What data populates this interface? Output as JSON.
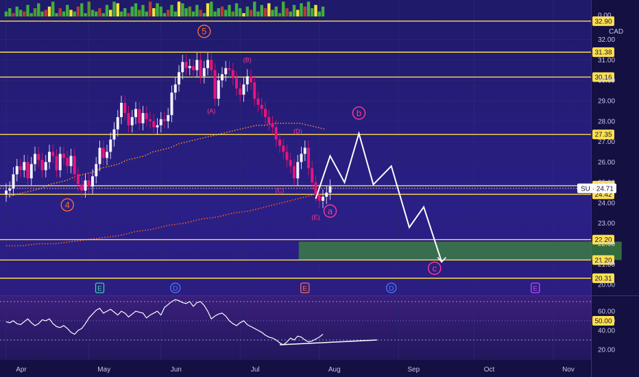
{
  "chart_data": {
    "type": "candlestick",
    "currency": "CAD",
    "symbol": "SU",
    "last_price": "24.71",
    "price_axis": {
      "ylim": [
        19.5,
        33.6
      ],
      "ticks": [
        "0.00",
        "32.00",
        "31.00",
        "30.00",
        "29.00",
        "28.00",
        "27.00",
        "26.00",
        "25.00",
        "24.00",
        "23.00",
        "22.00",
        "21.00",
        "20.00"
      ],
      "tick_values": [
        null,
        32,
        31,
        30,
        29,
        28,
        27,
        26,
        25,
        24,
        23,
        22,
        21,
        20
      ]
    },
    "time_axis": {
      "labels": [
        "Apr",
        "May",
        "Jun",
        "Jul",
        "Aug",
        "Sep",
        "Oct",
        "Nov"
      ],
      "label_day_index": [
        0,
        23,
        43,
        65,
        87,
        109,
        130,
        152
      ],
      "visible_days": 166
    },
    "horizontal_levels": [
      {
        "value": 32.9,
        "label": "32.90",
        "color": "#ffe14d"
      },
      {
        "value": 31.38,
        "label": "31.38",
        "color": "#ffe14d"
      },
      {
        "value": 30.16,
        "label": "30.16",
        "color": "#ffe14d"
      },
      {
        "value": 27.35,
        "label": "27.35",
        "color": "#ffe14d"
      },
      {
        "value": 24.84,
        "label": "24.84",
        "color": "#ffe14d"
      },
      {
        "value": 24.42,
        "label": "24.42",
        "color": "#ffe14d"
      },
      {
        "value": 22.2,
        "label": "22.20",
        "color": "#ffe14d"
      },
      {
        "value": 21.2,
        "label": "21.20",
        "color": "#ffe14d"
      },
      {
        "value": 20.31,
        "label": "20.31",
        "color": "#ffe14d"
      }
    ],
    "target_zone": {
      "from_day": 87,
      "to_day": 171,
      "top": 22.1,
      "bottom": 21.2,
      "color": "#3d8a3d"
    },
    "close_series": [
      24.6,
      24.7,
      25.4,
      25.8,
      25.6,
      26.0,
      25.2,
      25.9,
      26.4,
      26.1,
      25.6,
      26.0,
      26.5,
      26.3,
      25.6,
      26.4,
      26.2,
      25.8,
      26.3,
      25.4,
      24.9,
      24.6,
      25.1,
      24.8,
      25.3,
      25.9,
      26.7,
      26.2,
      26.5,
      27.1,
      27.6,
      28.2,
      28.9,
      28.4,
      27.8,
      28.2,
      28.6,
      27.9,
      28.4,
      28.1,
      28.0,
      27.7,
      27.8,
      28.1,
      28.0,
      28.3,
      29.4,
      29.8,
      30.4,
      30.9,
      30.6,
      30.7,
      30.5,
      31.0,
      30.2,
      30.6,
      31.0,
      30.5,
      29.1,
      30.0,
      30.3,
      30.6,
      30.5,
      30.1,
      29.6,
      29.3,
      29.8,
      30.2,
      29.9,
      29.1,
      28.8,
      28.6,
      28.2,
      27.9,
      27.7,
      27.1,
      26.8,
      26.5,
      26.1,
      25.8,
      25.2,
      26.0,
      26.4,
      26.7,
      25.7,
      25.0,
      24.4,
      24.1,
      24.3,
      24.5,
      24.8
    ],
    "ma_fast_series": [
      24.3,
      24.4,
      24.5,
      24.6,
      24.7,
      24.9,
      25.0,
      25.1,
      25.3,
      25.4,
      25.5,
      25.7,
      25.8,
      25.9,
      26.1,
      26.2,
      26.3,
      26.5,
      26.6,
      26.7,
      26.9,
      27.0,
      27.1,
      27.2,
      27.3,
      27.4,
      27.5,
      27.6,
      27.7,
      27.8,
      27.8,
      27.9,
      27.9,
      27.9,
      27.9,
      27.8,
      27.7,
      27.6
    ],
    "ma_fast_start_day": 0,
    "ma_slow_series": [
      21.9,
      21.9,
      22.0,
      22.0,
      22.1,
      22.2,
      22.3,
      22.4,
      22.6,
      22.7,
      22.9,
      23.0,
      23.2,
      23.3,
      23.5,
      23.6,
      23.8,
      24.0,
      24.2,
      24.4
    ],
    "forecast_path": [
      [
        86,
        24.2
      ],
      [
        90,
        26.3
      ],
      [
        94,
        25.0
      ],
      [
        98,
        27.4
      ],
      [
        102,
        24.9
      ],
      [
        107,
        25.8
      ],
      [
        112,
        22.8
      ],
      [
        116,
        23.8
      ],
      [
        121,
        21.1
      ]
    ],
    "wave_labels": [
      {
        "text": "5",
        "day": 55,
        "price": 32.4,
        "color": "#ff6b35",
        "ring": true
      },
      {
        "text": "4",
        "day": 17,
        "price": 23.9,
        "color": "#ff6b35",
        "ring": true
      },
      {
        "text": "b",
        "day": 98,
        "price": 28.4,
        "color": "#ff3c8e",
        "ring": true
      },
      {
        "text": "a",
        "day": 90,
        "price": 23.6,
        "color": "#ff3c8e",
        "ring": true
      },
      {
        "text": "c",
        "day": 119,
        "price": 20.8,
        "color": "#ff3c8e",
        "ring": true
      },
      {
        "text": "(A)",
        "day": 57,
        "price": 28.5,
        "color": "#ff3c8e",
        "ring": false
      },
      {
        "text": "(B)",
        "day": 67,
        "price": 31.0,
        "color": "#ff3c8e",
        "ring": false
      },
      {
        "text": "(C)",
        "day": 76,
        "price": 24.6,
        "color": "#ff3c8e",
        "ring": false
      },
      {
        "text": "(D)",
        "day": 81,
        "price": 27.5,
        "color": "#ff3c8e",
        "ring": false
      },
      {
        "text": "(E)",
        "day": 86,
        "price": 23.3,
        "color": "#ff3c8e",
        "ring": false
      }
    ],
    "event_markers": [
      {
        "text": "E",
        "day": 26,
        "color": "#3ad1a8"
      },
      {
        "text": "D",
        "day": 47,
        "color": "#4a7cff"
      },
      {
        "text": "E",
        "day": 83,
        "color": "#ff6b5a"
      },
      {
        "text": "D",
        "day": 107,
        "color": "#4a7cff"
      },
      {
        "text": "E",
        "day": 147,
        "color": "#c64aff"
      }
    ],
    "oscillator": {
      "ylim": [
        10,
        75
      ],
      "ticks": [
        "60.00",
        "50.00",
        "40.00",
        "20.00"
      ],
      "tick_values": [
        60,
        50,
        40,
        20
      ],
      "current_label": "50.00",
      "current_value": 50,
      "bands": [
        70,
        30
      ],
      "series": [
        49,
        48,
        50,
        47,
        46,
        49,
        52,
        48,
        45,
        47,
        51,
        50,
        52,
        47,
        44,
        43,
        45,
        42,
        38,
        36,
        40,
        42,
        47,
        53,
        57,
        61,
        63,
        58,
        60,
        62,
        59,
        56,
        60,
        58,
        54,
        57,
        60,
        59,
        58,
        53,
        56,
        58,
        60,
        56,
        64,
        67,
        70,
        72,
        71,
        69,
        68,
        70,
        65,
        69,
        70,
        66,
        60,
        52,
        55,
        57,
        58,
        55,
        50,
        47,
        45,
        48,
        50,
        46,
        44,
        42,
        40,
        38,
        35,
        33,
        32,
        30,
        27,
        25,
        28,
        32,
        30,
        34,
        33,
        30,
        28,
        29,
        31,
        33,
        36
      ],
      "trendline": [
        [
          76,
          25
        ],
        [
          103,
          30
        ]
      ]
    },
    "volume": {
      "colors": [
        "#3fae3f",
        "#5a8f2a",
        "#f6e23a",
        "#b83a3a"
      ],
      "series": [
        3,
        5,
        2,
        6,
        4,
        3,
        7,
        2,
        5,
        8,
        3,
        4,
        6,
        9,
        2,
        5,
        3,
        7,
        4,
        3,
        6,
        8,
        2,
        9,
        4,
        3,
        5,
        2,
        7,
        4,
        9,
        8,
        3,
        5,
        2,
        6,
        8,
        4,
        7,
        3,
        9,
        5,
        8,
        6,
        2,
        4,
        7,
        3,
        9,
        8,
        5,
        6,
        3,
        7,
        4,
        2,
        8,
        9,
        3,
        5,
        6,
        4,
        7,
        3,
        8,
        5,
        2,
        6,
        4,
        9,
        3,
        7,
        5,
        8,
        4,
        6,
        2,
        9,
        5,
        3,
        7,
        4,
        8,
        6,
        9,
        5,
        7,
        3,
        6
      ],
      "color_index": [
        0,
        0,
        3,
        0,
        0,
        3,
        0,
        0,
        1,
        0,
        0,
        3,
        2,
        0,
        0,
        3,
        0,
        0,
        2,
        0,
        3,
        0,
        0,
        1,
        0,
        0,
        3,
        0,
        0,
        2,
        0,
        2,
        0,
        0,
        3,
        0,
        0,
        1,
        0,
        0,
        3,
        2,
        0,
        0,
        0,
        3,
        0,
        0,
        2,
        0,
        0,
        1,
        0,
        0,
        3,
        0,
        2,
        0,
        0,
        0,
        3,
        0,
        0,
        1,
        0,
        0,
        2,
        0,
        3,
        0,
        0,
        0,
        3,
        2,
        0,
        0,
        1,
        0,
        3,
        0,
        0,
        2,
        0,
        3,
        0,
        0,
        2,
        0,
        0
      ]
    }
  }
}
